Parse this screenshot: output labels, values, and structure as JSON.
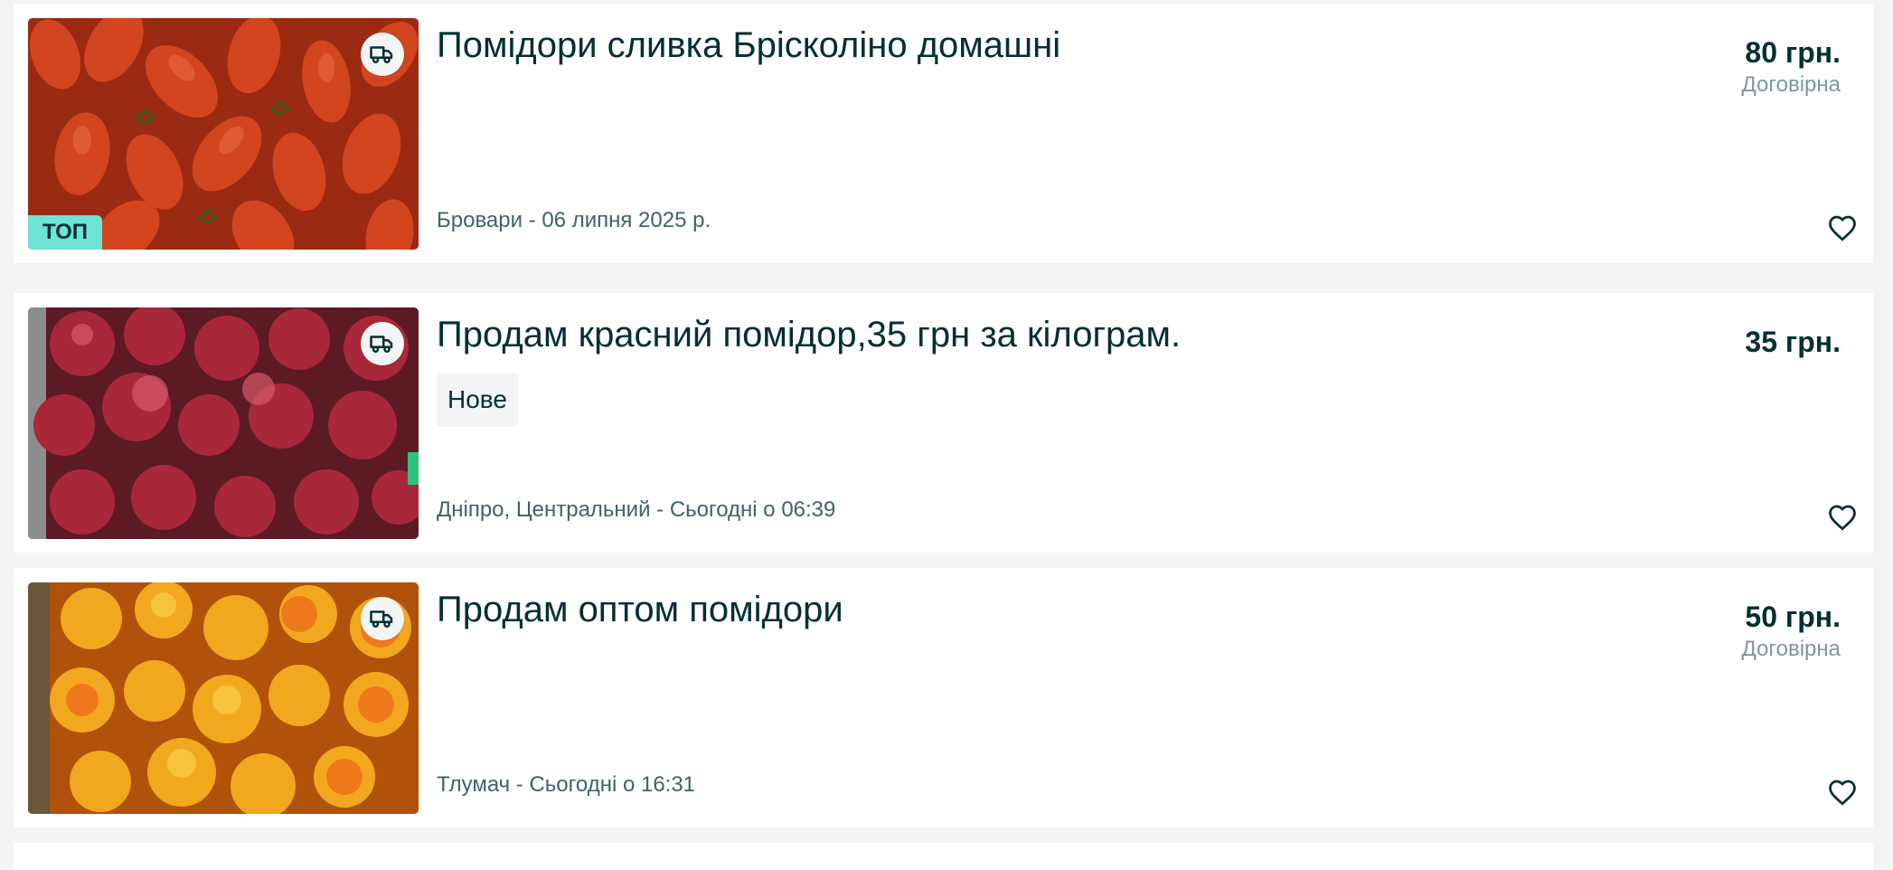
{
  "listings": [
    {
      "title": "Помідори сливка Брісколіно домашні",
      "price": "80 грн.",
      "negotiable": "Договірна",
      "location_date": "Бровари - 06 липня 2025 р.",
      "badge": "ТОП",
      "delivery_icon": "truck-icon",
      "favorite_icon": "heart-icon",
      "photo_color": "#c8401f"
    },
    {
      "title": "Продам красний помідор,35 грн за кілограм.",
      "price": "35 грн.",
      "condition": "Нове",
      "location_date": "Дніпро, Центральний - Сьогодні о 06:39",
      "delivery_icon": "truck-icon",
      "favorite_icon": "heart-icon",
      "photo_color": "#9c2535"
    },
    {
      "title": "Продам оптом помідори",
      "price": "50 грн.",
      "negotiable": "Договірна",
      "location_date": "Тлумач - Сьогодні о 16:31",
      "delivery_icon": "truck-icon",
      "favorite_icon": "heart-icon",
      "photo_color": "#f0a020"
    }
  ],
  "colors": {
    "text_primary": "#002f34",
    "text_secondary": "#406367",
    "text_muted": "#7f9799",
    "top_badge": "#6ee3d8",
    "page_bg": "#f2f4f5"
  }
}
